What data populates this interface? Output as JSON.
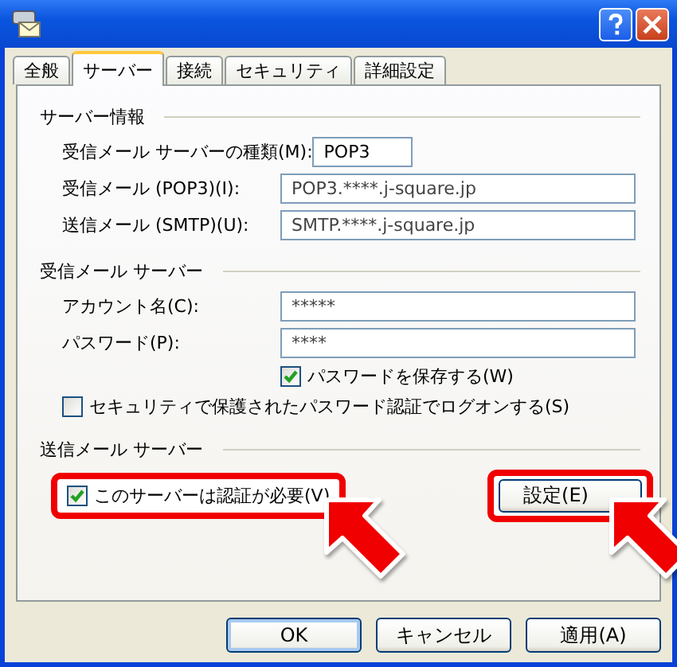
{
  "tabs": [
    {
      "label": "全般",
      "selected": false
    },
    {
      "label": "サーバー",
      "selected": true
    },
    {
      "label": "接続",
      "selected": false
    },
    {
      "label": "セキュリティ",
      "selected": false
    },
    {
      "label": "詳細設定",
      "selected": false
    }
  ],
  "sections": [
    {
      "title": "サーバー情報",
      "rows": [
        {
          "kind": "short_field",
          "label": "受信メール サーバーの種類(M):",
          "value": "POP3"
        },
        {
          "kind": "field",
          "label": "受信メール (POP3)(I):",
          "value": "POP3.****.j-square.jp"
        },
        {
          "kind": "field",
          "label": "送信メール (SMTP)(U):",
          "value": "SMTP.****.j-square.jp"
        }
      ]
    },
    {
      "title": "受信メール サーバー",
      "rows": [
        {
          "kind": "field",
          "label": "アカウント名(C):",
          "value": "*****"
        },
        {
          "kind": "field",
          "label": "パスワード(P):",
          "value": "****"
        },
        {
          "kind": "sub_checkbox",
          "label": "パスワードを保存する(W)",
          "checked": true
        },
        {
          "kind": "checkbox",
          "label": "セキュリティで保護されたパスワード認証でログオンする(S)",
          "checked": false
        }
      ]
    },
    {
      "title": "送信メール サーバー",
      "rows": [
        {
          "kind": "checkbox_button",
          "label": "このサーバーは認証が必要(V)",
          "checked": true,
          "highlighted": true,
          "button": {
            "label": "設定(E)",
            "highlighted": true
          }
        }
      ]
    }
  ],
  "buttons": [
    {
      "label": "OK",
      "default": true
    },
    {
      "label": "キャンセル",
      "default": false
    },
    {
      "label": "適用(A)",
      "default": false
    }
  ]
}
